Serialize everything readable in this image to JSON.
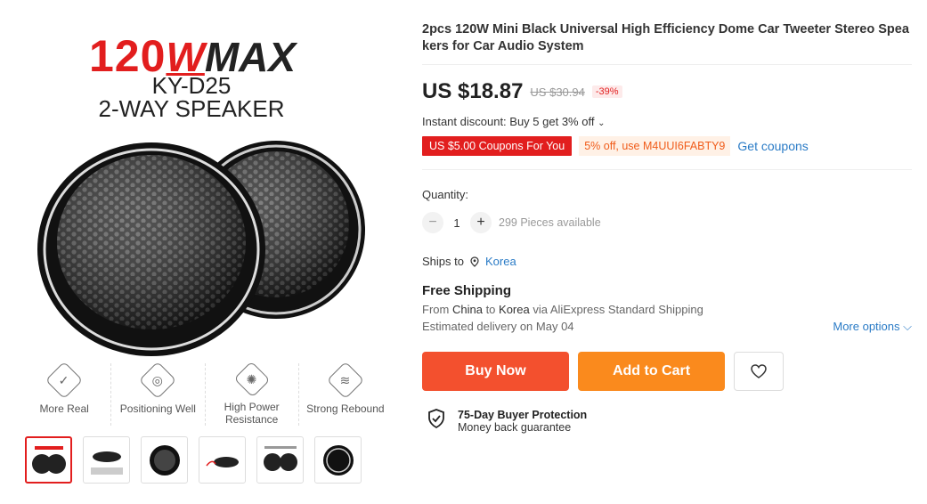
{
  "gallery": {
    "brand_num": "120",
    "brand_w": "W",
    "brand_max": "MAX",
    "model": "KY-D25",
    "model_sub": "2-WAY SPEAKER",
    "features": [
      {
        "label": "More Real",
        "icon": "check-icon"
      },
      {
        "label": "Positioning Well",
        "icon": "target-icon"
      },
      {
        "label": "High Power Resistance",
        "icon": "power-icon"
      },
      {
        "label": "Strong Rebound",
        "icon": "rebound-icon"
      }
    ]
  },
  "product": {
    "title": "2pcs 120W Mini Black Universal High Efficiency Dome Car Tweeter Stereo Speakers for Car Audio System",
    "price": "US $18.87",
    "original_price": "US $30.94",
    "discount": "-39%",
    "instant_discount": "Instant discount: Buy 5 get 3% off",
    "coupon_red": "US $5.00 Coupons For You",
    "coupon_code": "5% off, use M4UUI6FABTY9",
    "get_coupons": "Get coupons"
  },
  "quantity": {
    "label": "Quantity:",
    "value": "1",
    "available": "299 Pieces available"
  },
  "shipping": {
    "ships_to_label": "Ships to",
    "ships_to": "Korea",
    "free_shipping": "Free Shipping",
    "route_from": "From",
    "route_origin": "China",
    "route_to": "to",
    "route_dest": "Korea",
    "route_via": "via AliExpress Standard Shipping",
    "delivery": "Estimated delivery on May 04",
    "more_options": "More options"
  },
  "actions": {
    "buy_now": "Buy Now",
    "add_to_cart": "Add to Cart"
  },
  "protection": {
    "title": "75-Day Buyer Protection",
    "subtitle": "Money back guarantee"
  },
  "colors": {
    "price_red": "#e21e1e",
    "buy_now": "#f3502e",
    "add_to_cart": "#fa8a1d",
    "link_blue": "#2a7bc6"
  }
}
